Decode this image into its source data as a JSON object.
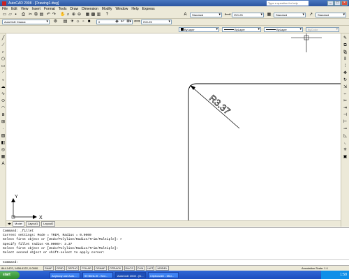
{
  "titlebar": {
    "title": "AutoCAD 2008 - [Drawing1.dwg]",
    "search_placeholder": "Type a question for help"
  },
  "menu": [
    "File",
    "Edit",
    "View",
    "Insert",
    "Format",
    "Tools",
    "Draw",
    "Dimension",
    "Modify",
    "Window",
    "Help",
    "Express"
  ],
  "toolbar1": {
    "text_style": "Standard",
    "dim_style": "ISO-25",
    "table_style": "Standard",
    "multileader_style": "Standard"
  },
  "toolbar2": {
    "workspace": "AutoCAD Classic",
    "layer": "0",
    "dim_scale": "ISO-25"
  },
  "toolbar3": {
    "color": "ByLayer",
    "linetype": "ByLayer",
    "lineweight": "ByLayer",
    "plotstyle": "ByColor"
  },
  "drawing": {
    "dimension_text": "R3.37",
    "ucs_x": "X",
    "ucs_y": "Y"
  },
  "tabs": [
    "Model",
    "Layout1",
    "Layout2"
  ],
  "command_history": [
    "Command: _fillet",
    "Current settings: Mode = TRIM, Radius = 0.0000",
    "Select first object or [Undo/Polyline/Radius/Trim/Multiple]: r",
    "Specify fillet radius <0.0000>: 3.37",
    "Select first object or [Undo/Polyline/Radius/Trim/Multiple]:",
    "Select second object or shift-select to apply corner:"
  ],
  "command_prompt": "Command:",
  "status": {
    "coords": "844.1470, 1458.4122, 0.0000",
    "toggles": [
      "SNAP",
      "GRID",
      "ORTHO",
      "POLAR",
      "OSNAP",
      "OTRACK",
      "DUCS",
      "DYN",
      "LWT",
      "MODEL"
    ],
    "annotation_scale": "Annotation Scale: 1:1"
  },
  "taskbar": {
    "start": "start",
    "tasks": [
      "Anybody use Auto...",
      "99 fillets.rtf - Wor...",
      "AutoCAD 2008 - [D...",
      "ClipboardD - Micr..."
    ],
    "clock": "1:58"
  }
}
